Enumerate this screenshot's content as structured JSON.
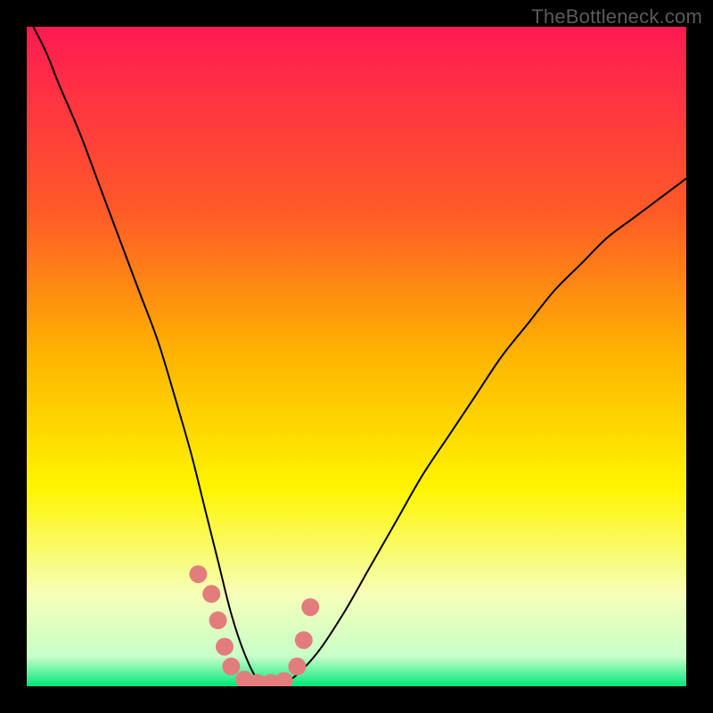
{
  "watermark": {
    "text": "TheBottleneck.com"
  },
  "chart_data": {
    "type": "line",
    "title": "",
    "xlabel": "",
    "ylabel": "",
    "xlim": [
      0,
      100
    ],
    "ylim": [
      0,
      100
    ],
    "grid": false,
    "legend": false,
    "background_gradient": {
      "direction": "top-to-bottom",
      "stops": [
        {
          "pos": 0.0,
          "color": "#ff1a52"
        },
        {
          "pos": 0.28,
          "color": "#ff5a28"
        },
        {
          "pos": 0.5,
          "color": "#ffb500"
        },
        {
          "pos": 0.7,
          "color": "#fff500"
        },
        {
          "pos": 0.86,
          "color": "#f6ffb8"
        },
        {
          "pos": 0.955,
          "color": "#c8ffc8"
        },
        {
          "pos": 1.0,
          "color": "#00e87a"
        }
      ]
    },
    "series": [
      {
        "name": "valley-curve",
        "color": "#000000",
        "width": 2,
        "x": [
          1,
          3,
          5,
          8,
          11,
          14,
          17,
          20,
          23,
          25,
          27,
          29,
          31,
          33,
          35,
          37,
          40,
          44,
          48,
          52,
          56,
          60,
          64,
          68,
          72,
          76,
          80,
          84,
          88,
          92,
          96,
          100
        ],
        "values": [
          100,
          96,
          91,
          84,
          76,
          68,
          60,
          52,
          42,
          35,
          27,
          19,
          11,
          5,
          1,
          0,
          1,
          5,
          11,
          18,
          25,
          32,
          38,
          44,
          50,
          55,
          60,
          64,
          68,
          71,
          74,
          77
        ]
      }
    ],
    "markers": {
      "name": "trough-dots",
      "color": "#e37d7d",
      "x": [
        26,
        28,
        29,
        30,
        31,
        33,
        35,
        37,
        39,
        41,
        42,
        43
      ],
      "values": [
        17,
        14,
        10,
        6,
        3,
        1,
        0.5,
        0.5,
        0.8,
        3,
        7,
        12
      ],
      "radius": 10
    }
  }
}
